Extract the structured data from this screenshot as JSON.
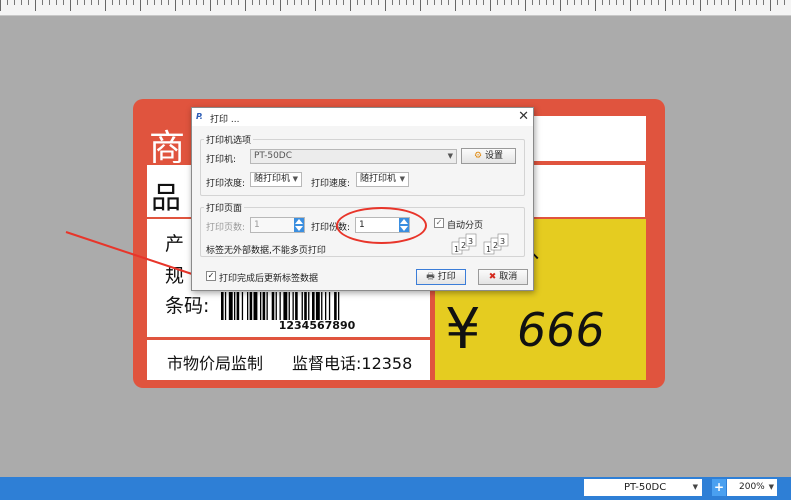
{
  "label": {
    "title_char": "商",
    "name_char": "品",
    "info_line1": "产",
    "info_line2": "规",
    "barcode_label": "条码:",
    "barcode_number": "1234567890",
    "currency": "¥",
    "price": "666",
    "footer_left": "市物价局监制",
    "footer_right": "监督电话:12358"
  },
  "dialog": {
    "logo": "P.",
    "title": "打印 ...",
    "close": "✕",
    "printer_group": "打印机选项",
    "printer_label": "打印机:",
    "printer_value": "PT-50DC",
    "settings_button": "设置",
    "density_label": "打印浓度:",
    "density_value": "随打印机",
    "speed_label": "打印速度:",
    "speed_value": "随打印机",
    "page_group": "打印页面",
    "pages_label": "打印页数:",
    "pages_value": "1",
    "copies_label": "打印份数:",
    "copies_value": "1",
    "auto_collate_label": "自动分页",
    "no_external_data": "标签无外部数据,不能多页打印",
    "update_after_print_label": "打印完成后更新标签数据",
    "print_button": "打印",
    "cancel_button": "取消",
    "collate_digits": [
      "1",
      "2",
      "3"
    ]
  },
  "statusbar": {
    "printer": "PT-50DC",
    "zoom_in": "+",
    "zoom": "200%"
  },
  "colors": {
    "label_red": "#e0543e",
    "price_yellow": "#e5cc20",
    "statusbar_blue": "#2e7fd6",
    "highlight_red": "#e8352a"
  }
}
